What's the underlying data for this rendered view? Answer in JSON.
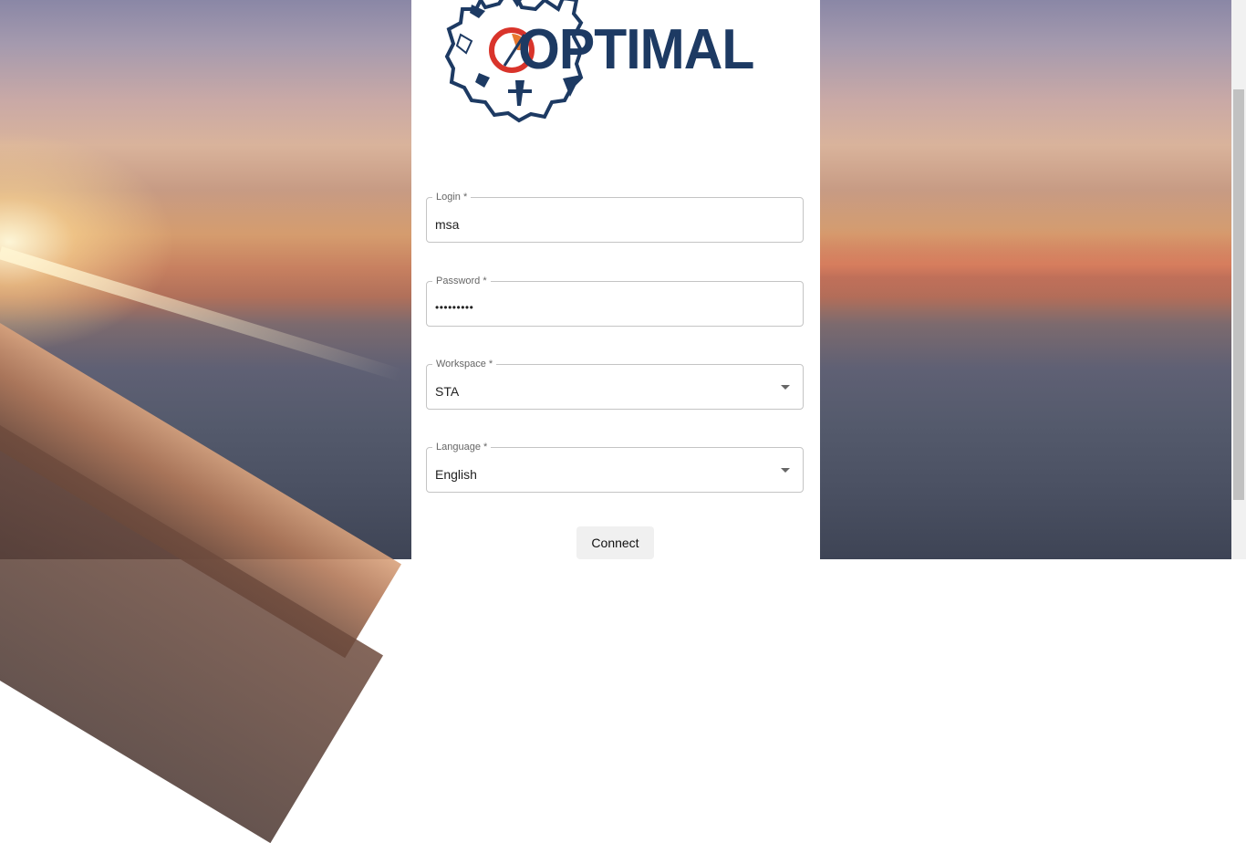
{
  "logo": {
    "text": "OPTIMAL",
    "primary_color": "#1d3a63",
    "accent_color": "#e8772e",
    "ring_color": "#d9342b"
  },
  "form": {
    "login": {
      "label": "Login *",
      "value": "msa"
    },
    "password": {
      "label": "Password *",
      "value": "•••••••••"
    },
    "workspace": {
      "label": "Workspace *",
      "value": "STA"
    },
    "language": {
      "label": "Language *",
      "value": "English"
    },
    "connect_label": "Connect"
  }
}
